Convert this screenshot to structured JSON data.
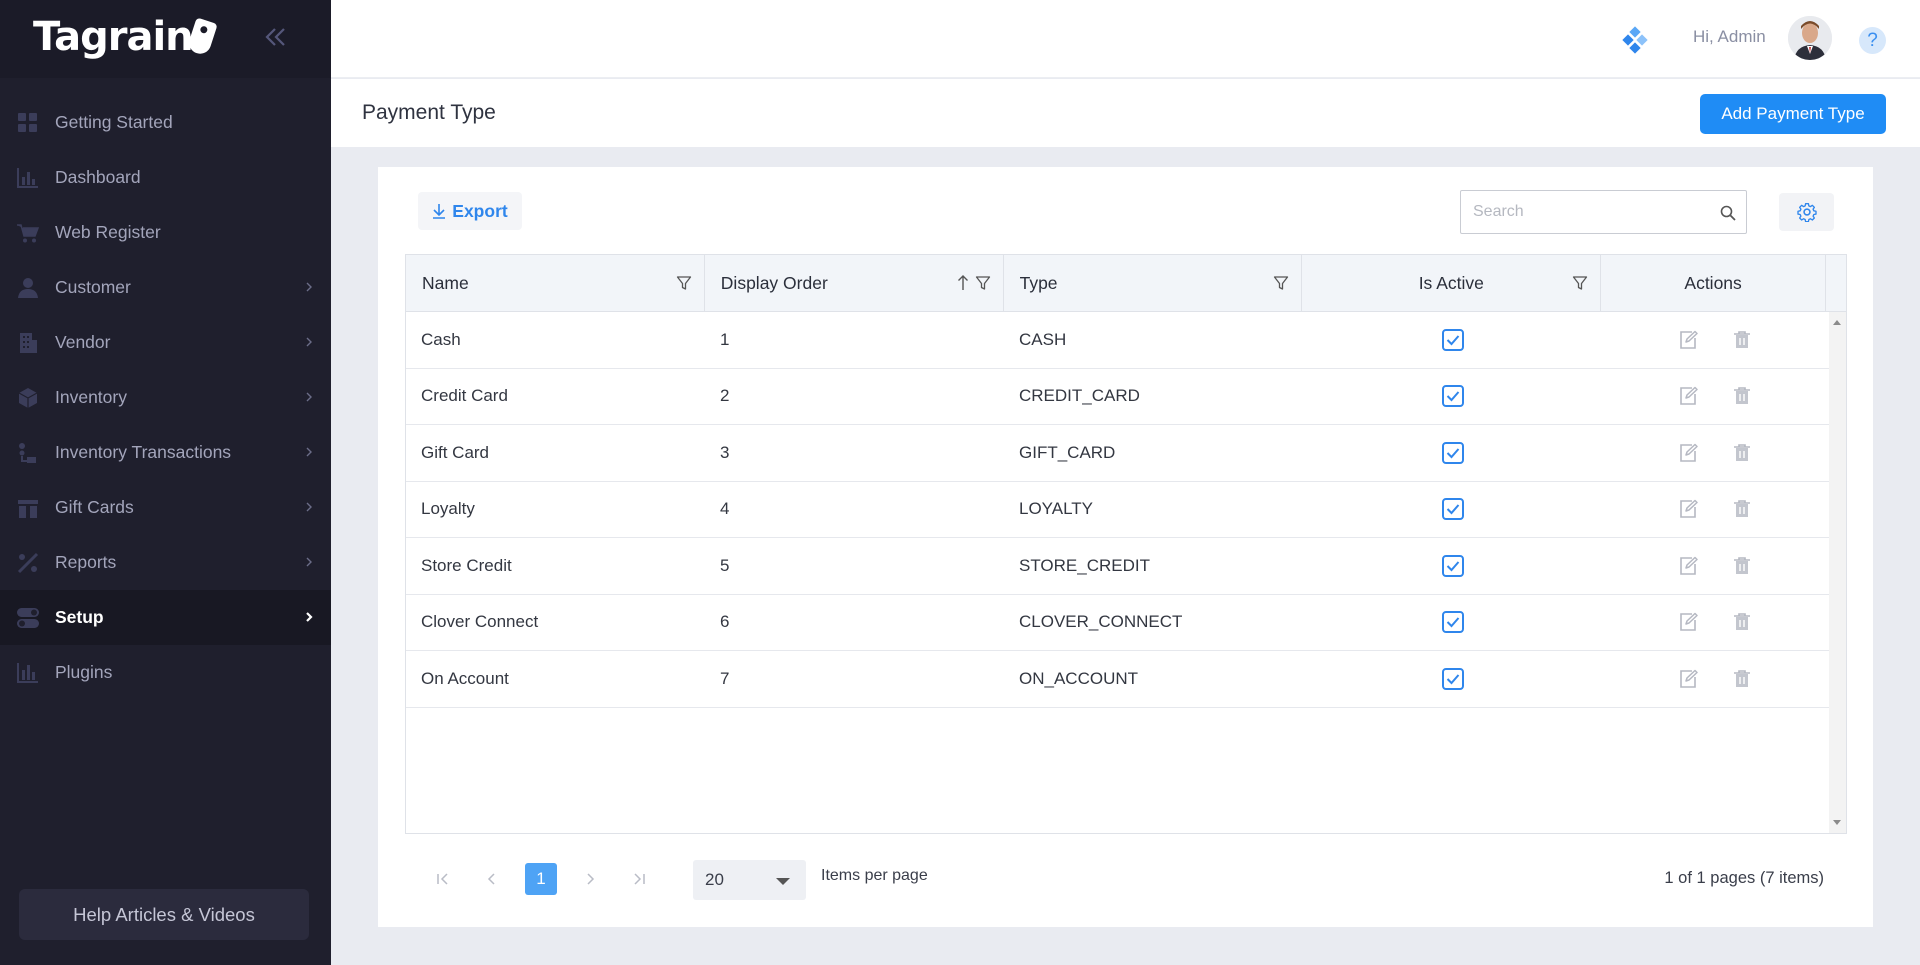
{
  "brand": {
    "name": "Tagrain"
  },
  "sidebar": {
    "items": [
      {
        "label": "Getting Started",
        "icon": "grid-icon",
        "chevron": false
      },
      {
        "label": "Dashboard",
        "icon": "bar-chart-icon",
        "chevron": false
      },
      {
        "label": "Web Register",
        "icon": "cart-icon",
        "chevron": false
      },
      {
        "label": "Customer",
        "icon": "user-icon",
        "chevron": true
      },
      {
        "label": "Vendor",
        "icon": "building-icon",
        "chevron": true
      },
      {
        "label": "Inventory",
        "icon": "box-icon",
        "chevron": true
      },
      {
        "label": "Inventory Transactions",
        "icon": "transactions-icon",
        "chevron": true
      },
      {
        "label": "Gift Cards",
        "icon": "gift-icon",
        "chevron": true
      },
      {
        "label": "Reports",
        "icon": "reports-icon",
        "chevron": true
      },
      {
        "label": "Setup",
        "icon": "toggle-icon",
        "chevron": true,
        "active": true
      },
      {
        "label": "Plugins",
        "icon": "plugins-icon",
        "chevron": false
      }
    ],
    "help_label": "Help Articles & Videos"
  },
  "topbar": {
    "greeting": "Hi, Admin",
    "help_glyph": "?"
  },
  "page": {
    "title": "Payment Type",
    "add_label": "Add Payment Type"
  },
  "toolbar": {
    "export_label": "Export",
    "search_placeholder": "Search"
  },
  "table": {
    "columns": [
      "Name",
      "Display Order",
      "Type",
      "Is Active",
      "Actions"
    ],
    "rows": [
      {
        "name": "Cash",
        "order": "1",
        "type": "CASH",
        "active": true
      },
      {
        "name": "Credit Card",
        "order": "2",
        "type": "CREDIT_CARD",
        "active": true
      },
      {
        "name": "Gift Card",
        "order": "3",
        "type": "GIFT_CARD",
        "active": true
      },
      {
        "name": "Loyalty",
        "order": "4",
        "type": "LOYALTY",
        "active": true
      },
      {
        "name": "Store Credit",
        "order": "5",
        "type": "STORE_CREDIT",
        "active": true
      },
      {
        "name": "Clover Connect",
        "order": "6",
        "type": "CLOVER_CONNECT",
        "active": true
      },
      {
        "name": "On Account",
        "order": "7",
        "type": "ON_ACCOUNT",
        "active": true
      }
    ]
  },
  "pager": {
    "current_page": "1",
    "page_size": "20",
    "items_per_page_label": "Items per page",
    "info": "1 of 1 pages (7 items)"
  },
  "colors": {
    "accent": "#1f8cf5",
    "sidebar_bg": "#1f1f2d",
    "checkbox": "#2f86ec"
  }
}
